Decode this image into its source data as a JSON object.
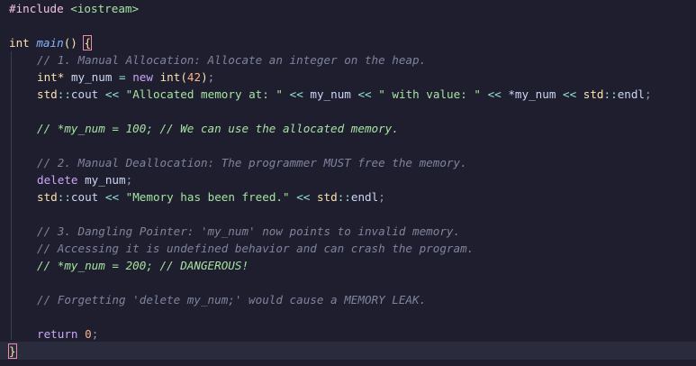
{
  "editor": {
    "lines": {
      "l1": {
        "pp": "#include",
        "inc": "<iostream>"
      },
      "l3": {
        "type": "int",
        "fn": "main",
        "parens": "()",
        "brace": "{"
      },
      "l4": {
        "comment": "// 1. Manual Allocation: Allocate an integer on the heap."
      },
      "l5": {
        "type": "int*",
        "id": "my_num",
        "op": "=",
        "kw": "new",
        "type2": "int",
        "lp": "(",
        "num": "42",
        "rp": ")",
        "semi": ";"
      },
      "l6": {
        "ns": "std",
        "sep": "::",
        "id": "cout",
        "op1": "<<",
        "str1": "\"Allocated memory at: \"",
        "op2": "<<",
        "id2": "my_num",
        "op3": "<<",
        "str2": "\" with value: \"",
        "op4": "<<",
        "deref": "*my_num",
        "op5": "<<",
        "ns2": "std",
        "sep2": "::",
        "id3": "endl",
        "semi": ";"
      },
      "l8": {
        "comment": "// *my_num = 100; // We can use the allocated memory."
      },
      "l10": {
        "comment": "// 2. Manual Deallocation: The programmer MUST free the memory."
      },
      "l11": {
        "kw": "delete",
        "id": "my_num",
        "semi": ";"
      },
      "l12": {
        "ns": "std",
        "sep": "::",
        "id": "cout",
        "op1": "<<",
        "str": "\"Memory has been freed.\"",
        "op2": "<<",
        "ns2": "std",
        "sep2": "::",
        "id2": "endl",
        "semi": ";"
      },
      "l14": {
        "comment": "// 3. Dangling Pointer: 'my_num' now points to invalid memory."
      },
      "l15": {
        "comment": "// Accessing it is undefined behavior and can crash the program."
      },
      "l16": {
        "comment": "// *my_num = 200; // DANGEROUS!"
      },
      "l18": {
        "comment": "// Forgetting 'delete my_num;' would cause a MEMORY LEAK."
      },
      "l20": {
        "kw": "return",
        "num": "0",
        "semi": ";"
      },
      "l21": {
        "brace": "}"
      }
    },
    "colors": {
      "background": "#1e1e2e",
      "comment": "#7f849c",
      "keyword": "#cba6f7",
      "string": "#a6e3a1",
      "type": "#f9e2af",
      "number": "#fab387"
    }
  }
}
